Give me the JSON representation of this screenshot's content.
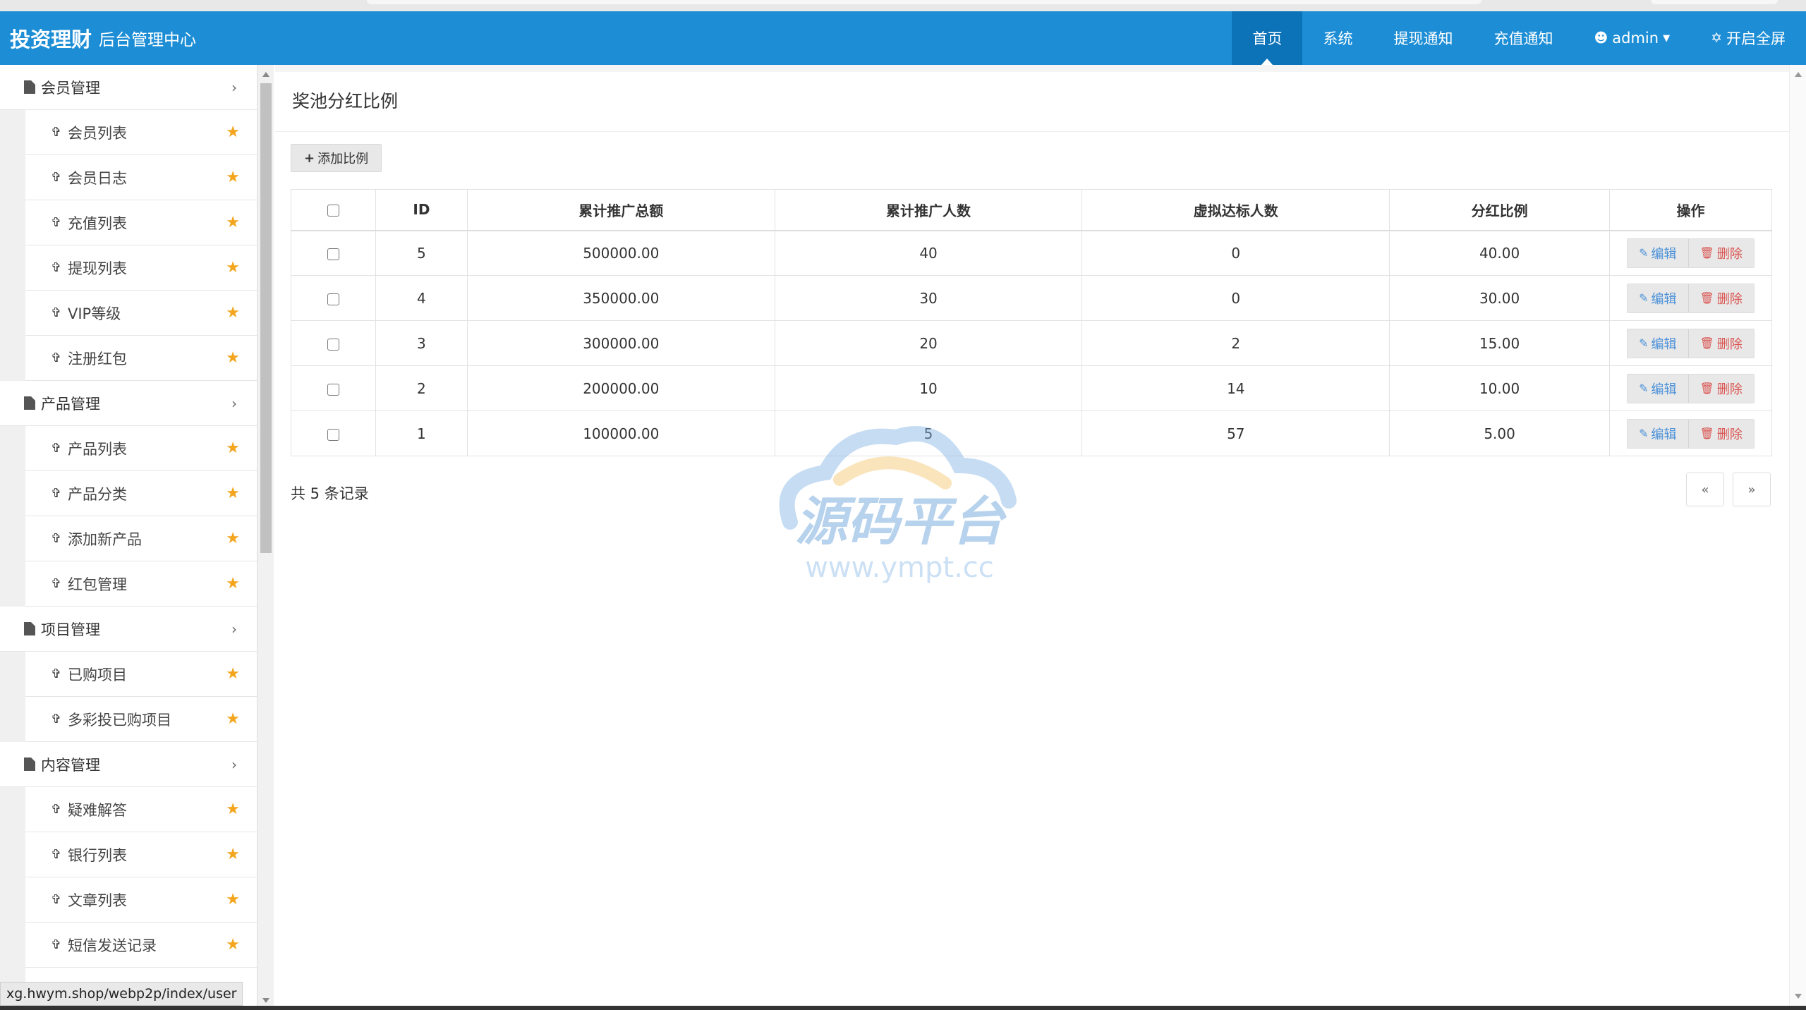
{
  "header": {
    "brand_name": "投资理财",
    "brand_sub": "后台管理中心",
    "nav": [
      {
        "label": "首页",
        "active": true
      },
      {
        "label": "系统"
      },
      {
        "label": "提现通知"
      },
      {
        "label": "充值通知"
      },
      {
        "label": "admin",
        "icon": "user-icon"
      },
      {
        "label": "开启全屏",
        "icon": "fullscreen-icon"
      }
    ]
  },
  "sidebar": {
    "groups": [
      {
        "label": "会员管理",
        "items": [
          "会员列表",
          "会员日志",
          "充值列表",
          "提现列表",
          "VIP等级",
          "注册红包"
        ]
      },
      {
        "label": "产品管理",
        "items": [
          "产品列表",
          "产品分类",
          "添加新产品",
          "红包管理"
        ]
      },
      {
        "label": "项目管理",
        "items": [
          "已购项目",
          "多彩投已购项目"
        ]
      },
      {
        "label": "内容管理",
        "items": [
          "疑难解答",
          "银行列表",
          "文章列表",
          "短信发送记录"
        ]
      }
    ]
  },
  "main": {
    "title": "奖池分红比例",
    "add_button": "添加比例",
    "columns": [
      "ID",
      "累计推广总额",
      "累计推广人数",
      "虚拟达标人数",
      "分红比例",
      "操作"
    ],
    "rows": [
      {
        "id": "5",
        "total": "500000.00",
        "people": "40",
        "virtual": "0",
        "ratio": "40.00"
      },
      {
        "id": "4",
        "total": "350000.00",
        "people": "30",
        "virtual": "0",
        "ratio": "30.00"
      },
      {
        "id": "3",
        "total": "300000.00",
        "people": "20",
        "virtual": "2",
        "ratio": "15.00"
      },
      {
        "id": "2",
        "total": "200000.00",
        "people": "10",
        "virtual": "14",
        "ratio": "10.00"
      },
      {
        "id": "1",
        "total": "100000.00",
        "people": "5",
        "virtual": "57",
        "ratio": "5.00"
      }
    ],
    "edit_label": "编辑",
    "delete_label": "删除",
    "record_count": "共 5 条记录",
    "pager_prev": "«",
    "pager_next": "»"
  },
  "watermark": {
    "text": "源码平台",
    "url": "www.ympt.cc"
  },
  "status_url": "xg.hwym.shop/webp2p/index/user",
  "colors": {
    "header": "#1d8ed6",
    "header_active": "#0c73b8",
    "star": "#f3a51d",
    "edit": "#4a90d9",
    "delete": "#d9534f"
  }
}
